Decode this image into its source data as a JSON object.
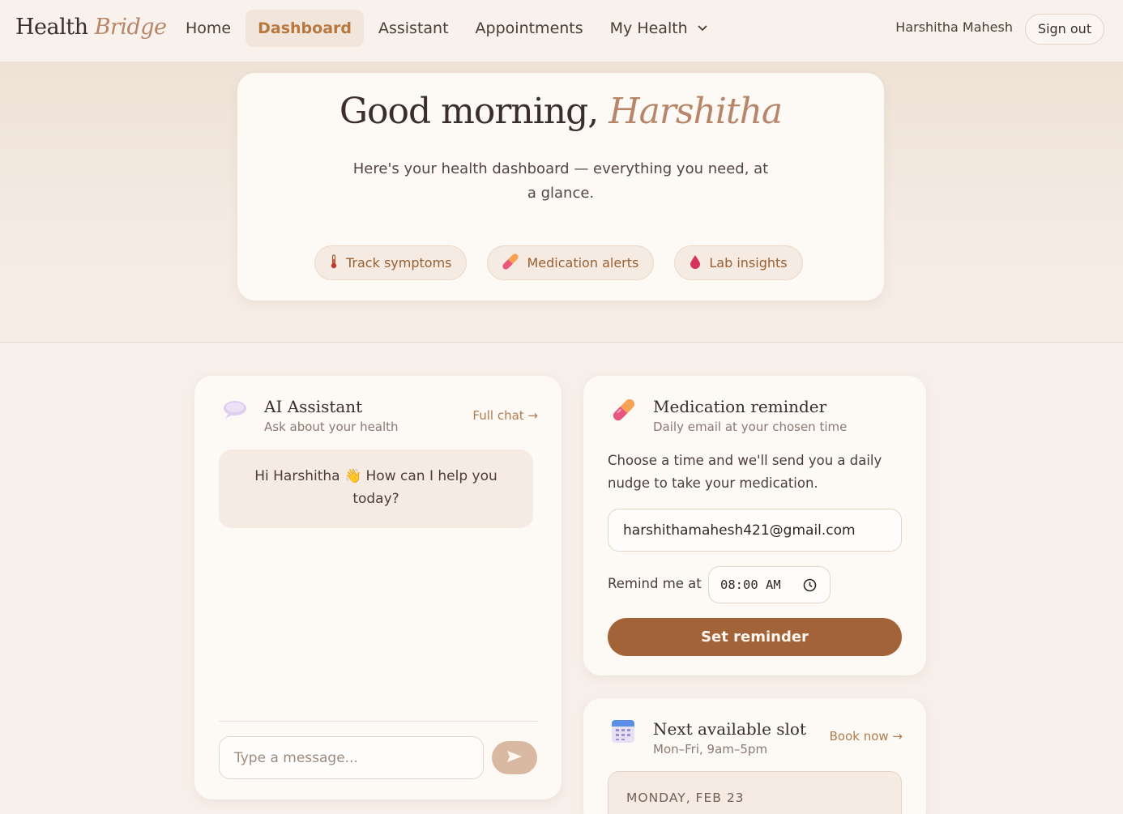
{
  "brand": {
    "part1": "Health",
    "part2": "Bridge"
  },
  "nav": {
    "links": [
      "Home",
      "Dashboard",
      "Assistant",
      "Appointments",
      "My Health"
    ],
    "active": "Dashboard"
  },
  "user": {
    "name": "Harshitha Mahesh",
    "sign_out": "Sign out"
  },
  "hero": {
    "greeting": "Good morning,",
    "name": "Harshitha",
    "subtitle": "Here's your health dashboard — everything you need, at a glance.",
    "chips": [
      {
        "label": "Track symptoms",
        "icon": "thermometer-icon"
      },
      {
        "label": "Medication alerts",
        "icon": "pill-icon"
      },
      {
        "label": "Lab insights",
        "icon": "blood-drop-icon"
      }
    ]
  },
  "assistant": {
    "title": "AI Assistant",
    "subtitle": "Ask about your health",
    "link": "Full chat →",
    "greeting": "Hi Harshitha 👋 How can I help you today?",
    "input_placeholder": "Type a message..."
  },
  "medication": {
    "title": "Medication reminder",
    "subtitle": "Daily email at your chosen time",
    "description": "Choose a time and we'll send you a daily nudge to take your medication.",
    "email": "harshithamahesh421@gmail.com",
    "remind_label": "Remind me at",
    "time": "08:00 AM",
    "button": "Set reminder"
  },
  "slot": {
    "title": "Next available slot",
    "subtitle": "Mon–Fri, 9am–5pm",
    "link": "Book now →",
    "date": "MONDAY, FEB 23"
  },
  "colors": {
    "accent": "#b7866a",
    "button": "#a36338",
    "background": "#f7efe9"
  }
}
